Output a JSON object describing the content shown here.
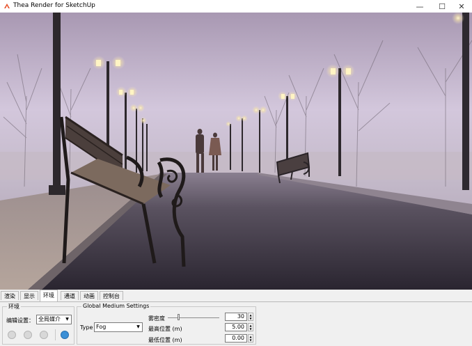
{
  "window": {
    "title": "Thea Render for SketchUp",
    "minimize_glyph": "—",
    "maximize_glyph": "☐",
    "close_glyph": "✕",
    "app_icon": "thea-logo-icon"
  },
  "viewport": {
    "description_icon": "render-preview-image"
  },
  "tabs": [
    {
      "label": "渲染",
      "active": false
    },
    {
      "label": "显示",
      "active": false
    },
    {
      "label": "环境",
      "active": true
    },
    {
      "label": "通道",
      "active": false
    },
    {
      "label": "动画",
      "active": false
    },
    {
      "label": "控制台",
      "active": false
    }
  ],
  "environment_group": {
    "title": "环境",
    "edit_label": "编辑设置：",
    "edit_value": "全局媒介",
    "buttons": [
      "globe-disabled-icon",
      "sun-disabled-icon",
      "sky-disabled-icon",
      "medium-globe-icon"
    ]
  },
  "medium_group": {
    "title": "Global Medium Settings",
    "type_label": "Type",
    "type_value": "Fog",
    "density_label": "雾密度",
    "density_value": "30",
    "density_level": 0.2,
    "max_label": "最高位置 (m)",
    "max_value": "5.00",
    "min_label": "最低位置 (m)",
    "min_value": "0.00"
  },
  "colors": {
    "accent": "#3b8fd6",
    "fog": "#cbbfd3",
    "ground": "#3b3540"
  }
}
